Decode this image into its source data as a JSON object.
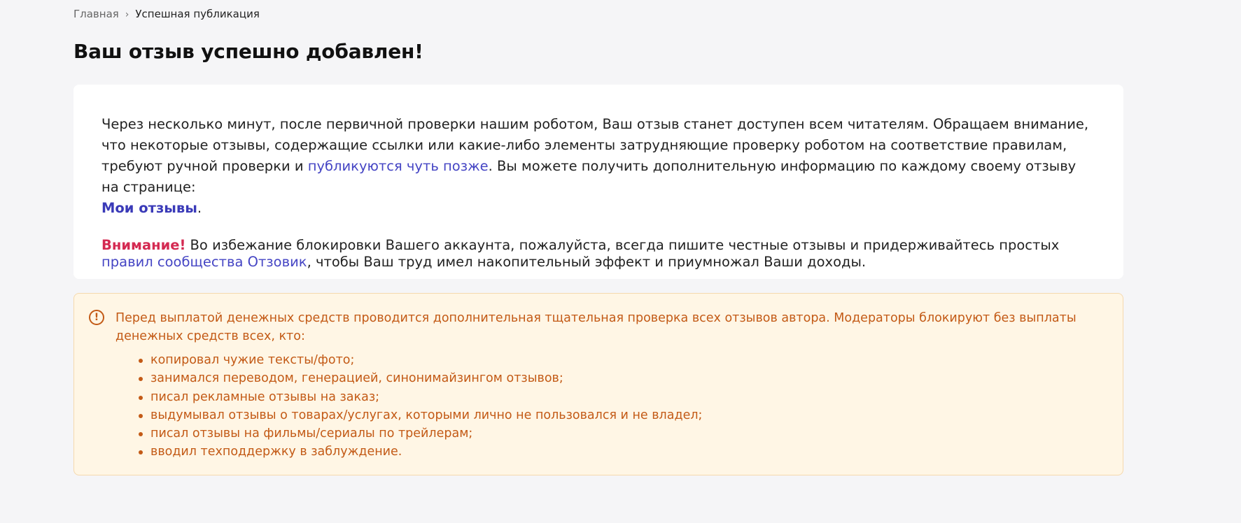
{
  "breadcrumb": {
    "home": "Главная",
    "separator": "›",
    "current": "Успешная публикация"
  },
  "page_title": "Ваш отзыв успешно добавлен!",
  "info_card": {
    "paragraph1_part1": "Через несколько минут, после первичной проверки нашим роботом, Ваш отзыв станет доступен всем читателям. Обращаем внимание, что некоторые отзывы, содержащие ссылки или какие-либо элементы затрудняющие проверку роботом на соответствие правилам, требуют ручной проверки и ",
    "later_link": "публикуются чуть позже",
    "paragraph1_part2": ". Вы можете получить дополнительную информацию по каждому своему отзыву на странице:",
    "my_reviews_link": "Мои отзывы",
    "paragraph1_end": ".",
    "attention_label": "Внимание!",
    "paragraph2_part1": " Во избежание блокировки Вашего аккаунта, пожалуйста, всегда пишите честные отзывы и придерживайтесь простых ",
    "rules_link": "правил сообщества Отзовик",
    "paragraph2_part2": ", чтобы Ваш труд имел накопительный эффект и приумножал Ваши доходы."
  },
  "notice": {
    "icon": "exclamation-circle-icon",
    "text": "Перед выплатой денежных средств проводится дополнительная тщательная проверка всех отзывов автора. Модераторы блокируют без выплаты денежных средств всех, кто:",
    "items": [
      "копировал чужие тексты/фото;",
      "занимался переводом, генерацией, синонимайзингом отзывов;",
      "писал рекламные отзывы на заказ;",
      "выдумывал отзывы о товарах/услугах, которыми лично не пользовался и не владел;",
      "писал отзывы на фильмы/сериалы по трейлерам;",
      "вводил техподдержку в заблуждение."
    ]
  },
  "colors": {
    "page_background": "#f5f5f7",
    "link": "#4545c4",
    "attention": "#d42a52",
    "notice_text": "#c35a16",
    "notice_background": "#fff6e5",
    "notice_border": "#f5d9ad"
  }
}
